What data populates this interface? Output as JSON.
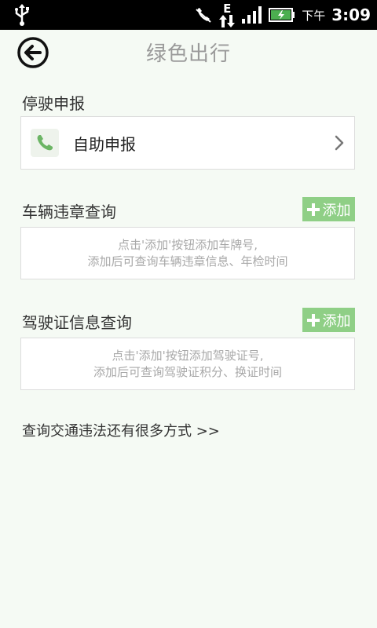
{
  "status_bar": {
    "ampm": "下午",
    "time": "3:09",
    "network_label": "E",
    "icons": [
      "usb-icon",
      "mute-icon",
      "data-arrows-icon",
      "signal-icon",
      "battery-charging-icon"
    ]
  },
  "header": {
    "title": "绿色出行",
    "back_icon": "back-arrow-icon"
  },
  "self_report": {
    "section_label": "停驶申报",
    "item_label": "自助申报",
    "icon": "phone-icon"
  },
  "vehicle_violation": {
    "section_label": "车辆违章查询",
    "add_label": "添加",
    "hint_line1": "点击'添加'按钮添加车牌号,",
    "hint_line2": "添加后可查询车辆违章信息、年检时间"
  },
  "license_info": {
    "section_label": "驾驶证信息查询",
    "add_label": "添加",
    "hint_line1": "点击'添加'按钮添加驾驶证号,",
    "hint_line2": "添加后可查询驾驶证积分、换证时间"
  },
  "more_link": "查询交通违法还有很多方式 >>",
  "colors": {
    "background": "#f5faf4",
    "accent_green": "#8fcf86",
    "status_bar": "#000000"
  }
}
